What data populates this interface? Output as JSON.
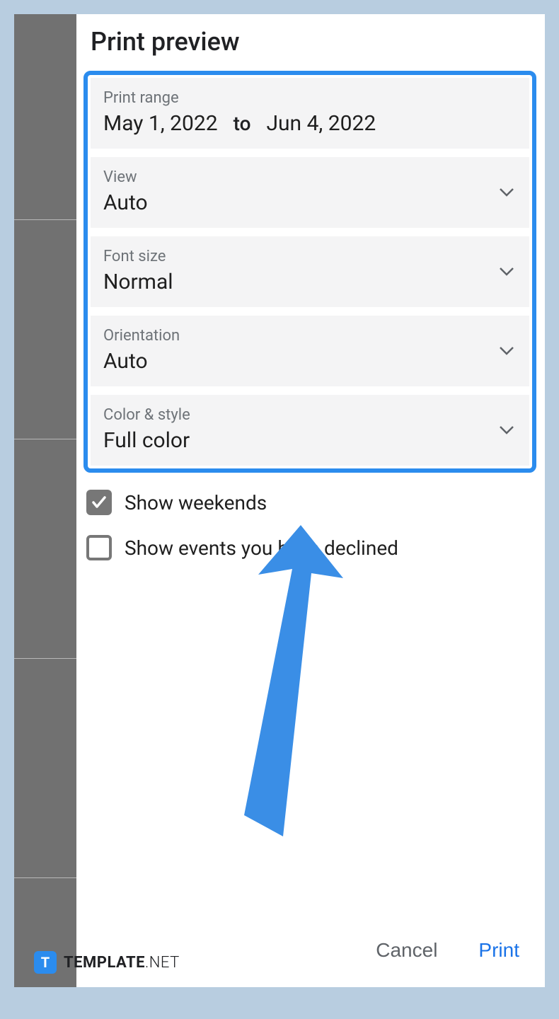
{
  "title": "Print preview",
  "fields": {
    "range": {
      "label": "Print range",
      "start": "May 1, 2022",
      "to": "to",
      "end": "Jun 4, 2022"
    },
    "view": {
      "label": "View",
      "value": "Auto"
    },
    "fontsize": {
      "label": "Font size",
      "value": "Normal"
    },
    "orientation": {
      "label": "Orientation",
      "value": "Auto"
    },
    "colorstyle": {
      "label": "Color & style",
      "value": "Full color"
    }
  },
  "checkboxes": {
    "weekends": {
      "label": "Show weekends",
      "checked": true
    },
    "declined": {
      "label": "Show events you have declined",
      "checked": false
    }
  },
  "footer": {
    "cancel": "Cancel",
    "print": "Print"
  },
  "watermark": {
    "badge": "T",
    "bold": "TEMPLATE",
    "light": ".NET"
  },
  "colors": {
    "accent": "#2b8cee",
    "link": "#1a73e8"
  }
}
